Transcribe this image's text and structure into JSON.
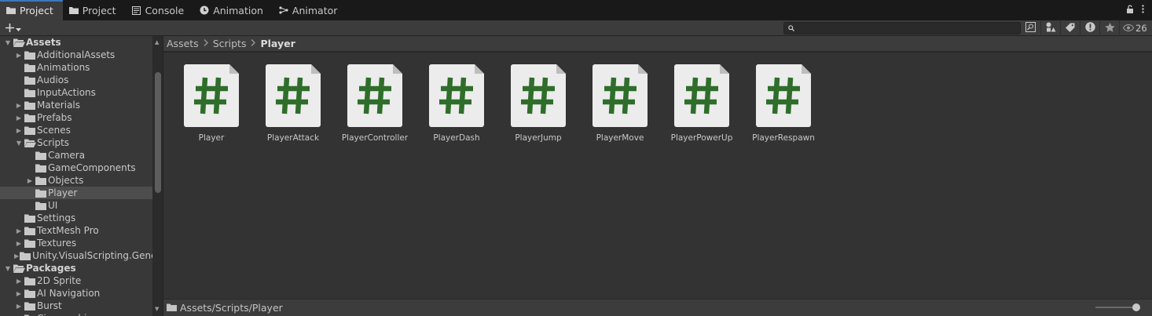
{
  "tabs": [
    {
      "label": "Project",
      "icon": "folder-icon",
      "active": true
    },
    {
      "label": "Project",
      "icon": "folder-icon",
      "active": false
    },
    {
      "label": "Console",
      "icon": "console-icon",
      "active": false
    },
    {
      "label": "Animation",
      "icon": "animation-icon",
      "active": false
    },
    {
      "label": "Animator",
      "icon": "animator-icon",
      "active": false
    }
  ],
  "toolbar": {
    "search_value": "",
    "eye_count": "26"
  },
  "tree": [
    {
      "label": "Assets",
      "depth": 0,
      "arrow": "down",
      "open": true,
      "bold": true
    },
    {
      "label": "AdditionalAssets",
      "depth": 1,
      "arrow": "right"
    },
    {
      "label": "Animations",
      "depth": 1,
      "arrow": ""
    },
    {
      "label": "Audios",
      "depth": 1,
      "arrow": ""
    },
    {
      "label": "InputActions",
      "depth": 1,
      "arrow": ""
    },
    {
      "label": "Materials",
      "depth": 1,
      "arrow": "right"
    },
    {
      "label": "Prefabs",
      "depth": 1,
      "arrow": "right"
    },
    {
      "label": "Scenes",
      "depth": 1,
      "arrow": "right"
    },
    {
      "label": "Scripts",
      "depth": 1,
      "arrow": "down",
      "open": true
    },
    {
      "label": "Camera",
      "depth": 2,
      "arrow": ""
    },
    {
      "label": "GameComponents",
      "depth": 2,
      "arrow": ""
    },
    {
      "label": "Objects",
      "depth": 2,
      "arrow": "right"
    },
    {
      "label": "Player",
      "depth": 2,
      "arrow": "",
      "selected": true
    },
    {
      "label": "UI",
      "depth": 2,
      "arrow": ""
    },
    {
      "label": "Settings",
      "depth": 1,
      "arrow": ""
    },
    {
      "label": "TextMesh Pro",
      "depth": 1,
      "arrow": "right"
    },
    {
      "label": "Textures",
      "depth": 1,
      "arrow": "right"
    },
    {
      "label": "Unity.VisualScripting.Gene",
      "depth": 1,
      "arrow": "right"
    },
    {
      "label": "Packages",
      "depth": 0,
      "arrow": "down",
      "open": true,
      "bold": true
    },
    {
      "label": "2D Sprite",
      "depth": 1,
      "arrow": "right"
    },
    {
      "label": "AI Navigation",
      "depth": 1,
      "arrow": "right"
    },
    {
      "label": "Burst",
      "depth": 1,
      "arrow": "right"
    },
    {
      "label": "Cinemachine",
      "depth": 1,
      "arrow": "right"
    }
  ],
  "breadcrumb": [
    "Assets",
    "Scripts",
    "Player"
  ],
  "assets": [
    {
      "name": "Player"
    },
    {
      "name": "PlayerAttack"
    },
    {
      "name": "PlayerController"
    },
    {
      "name": "PlayerDash"
    },
    {
      "name": "PlayerJump"
    },
    {
      "name": "PlayerMove"
    },
    {
      "name": "PlayerPowerUp"
    },
    {
      "name": "PlayerRespawn"
    }
  ],
  "status": {
    "path": "Assets/Scripts/Player"
  },
  "colors": {
    "accent": "#3a79bb",
    "script_hash": "#2f6e2a",
    "script_page": "#ececec"
  }
}
